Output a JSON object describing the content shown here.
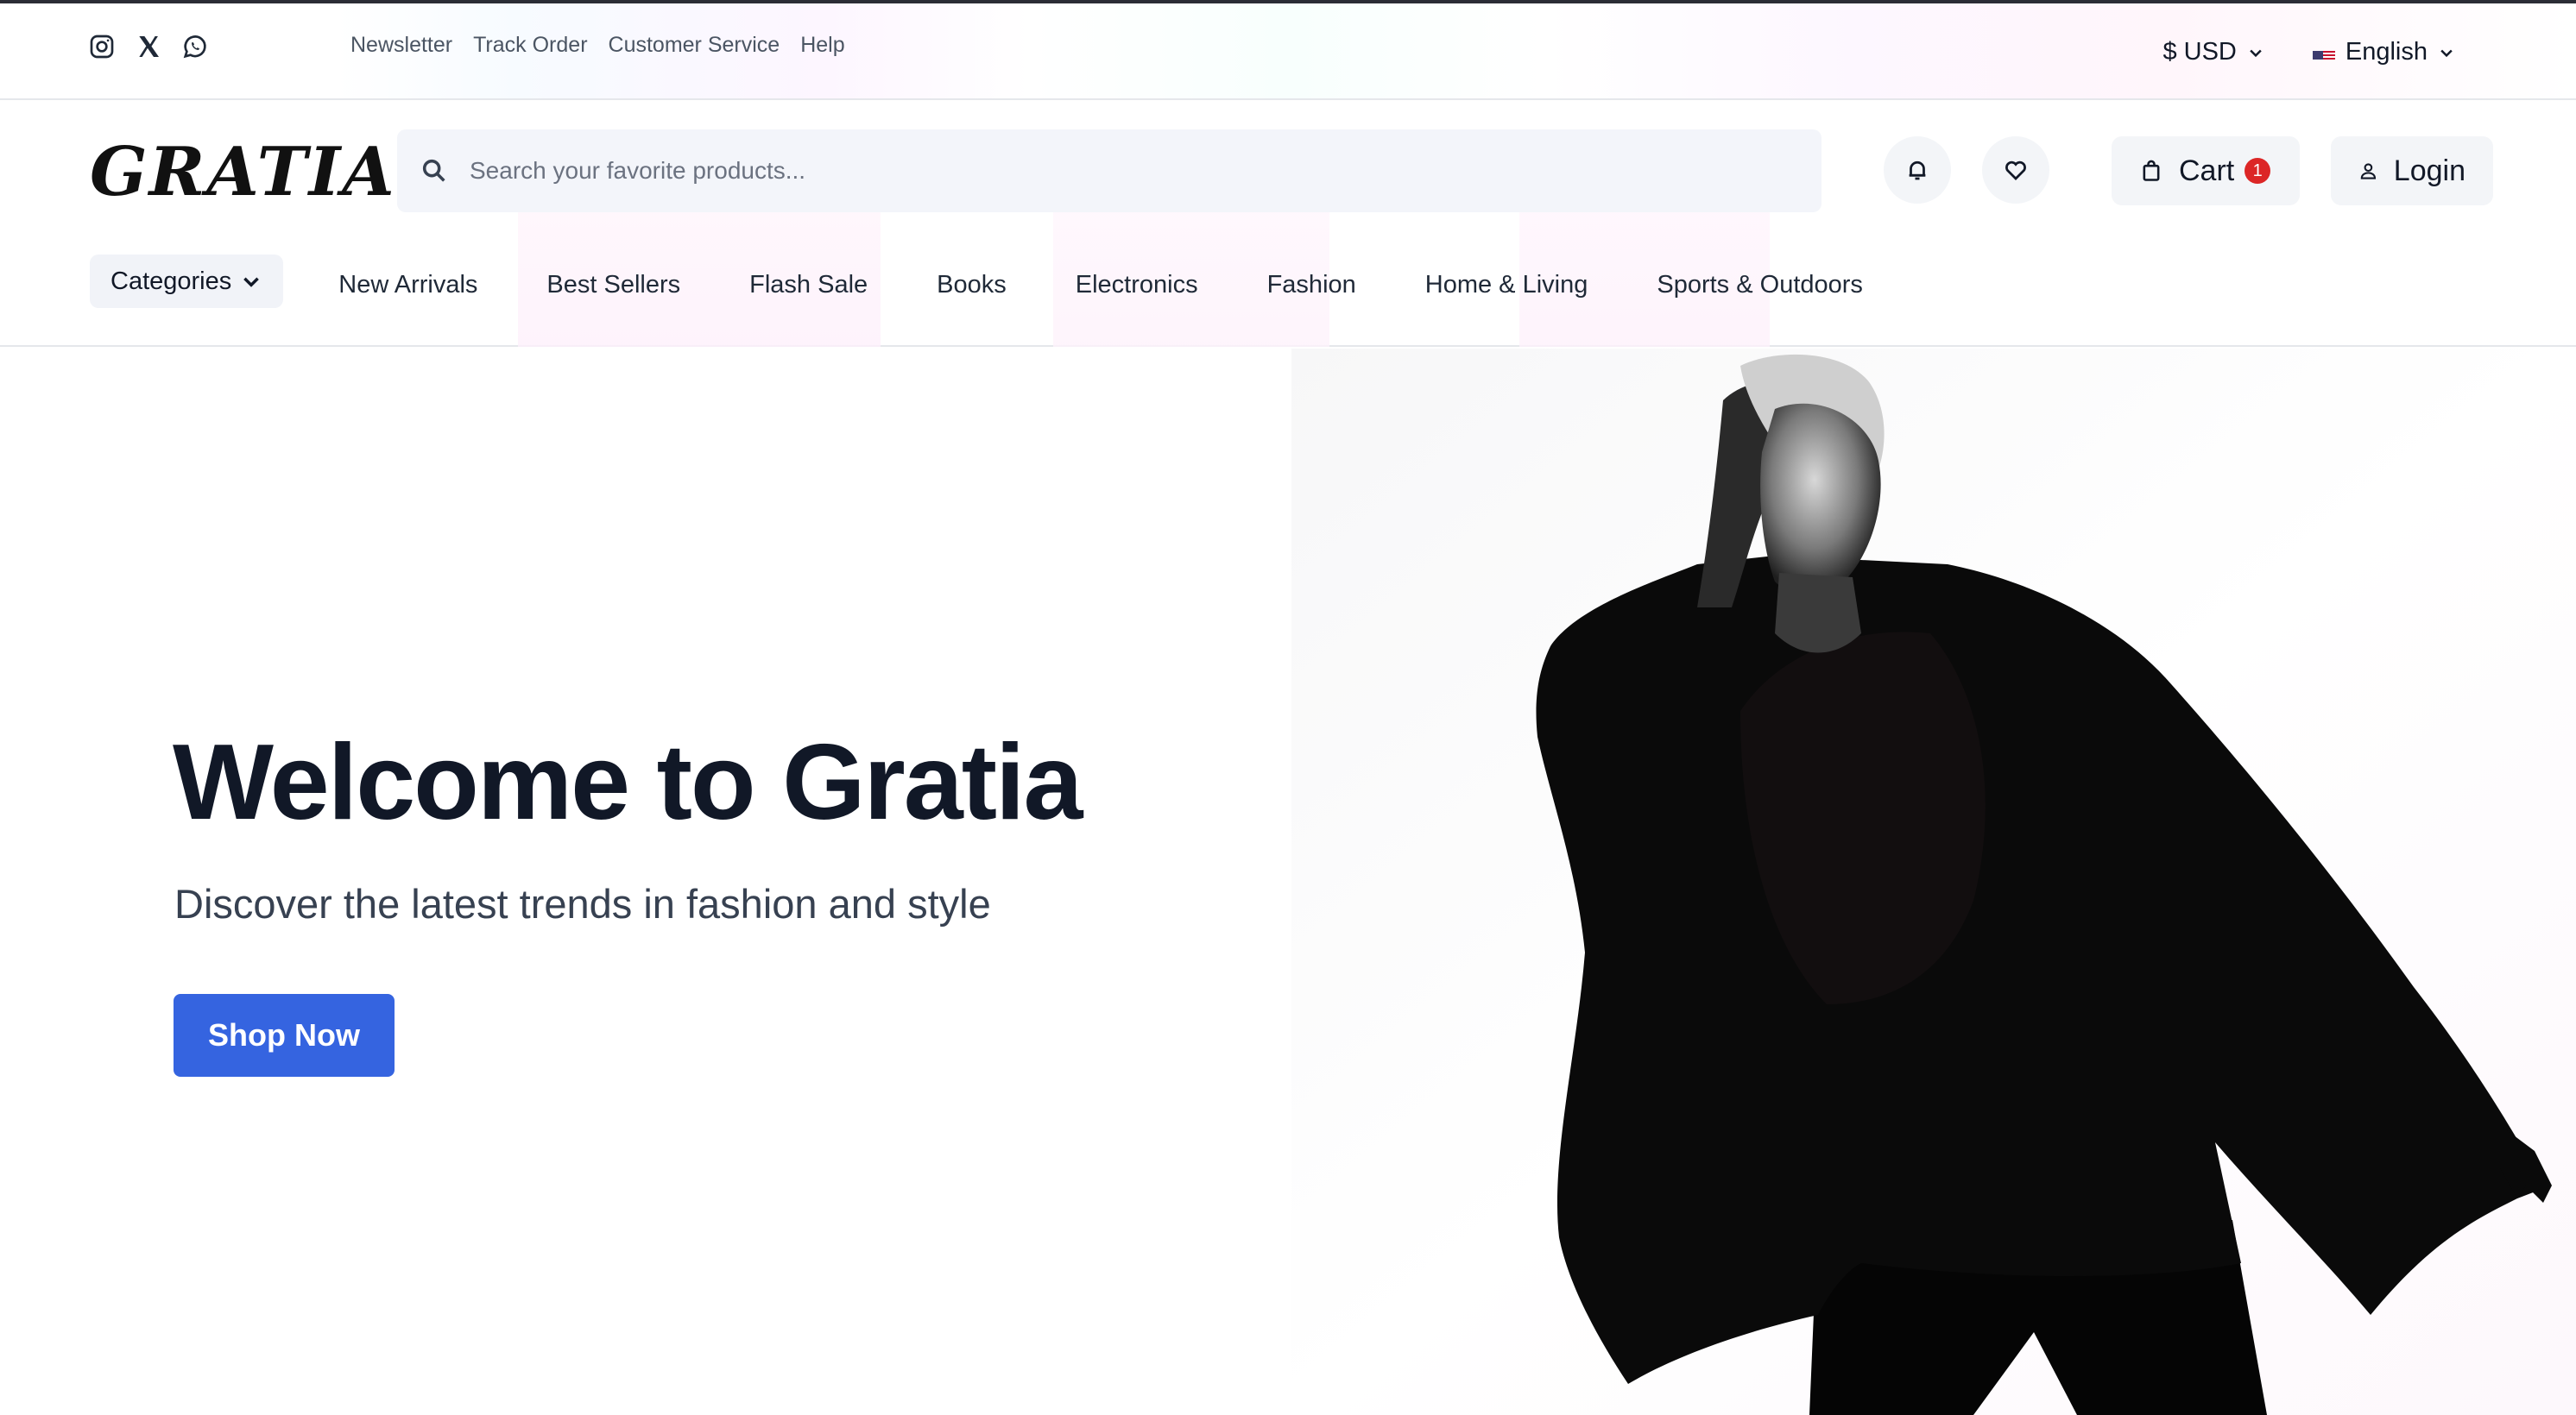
{
  "utility": {
    "social": [
      "instagram-icon",
      "x-twitter-icon",
      "whatsapp-icon"
    ],
    "links": [
      "Newsletter",
      "Track Order",
      "Customer Service",
      "Help"
    ],
    "currency": "$ USD",
    "language": "English"
  },
  "header": {
    "logo": "GRATIA",
    "search_placeholder": "Search your favorite products...",
    "cart_label": "Cart",
    "cart_count": "1",
    "login_label": "Login"
  },
  "nav": {
    "categories_label": "Categories",
    "items": [
      "New Arrivals",
      "Best Sellers",
      "Flash Sale",
      "Books",
      "Electronics",
      "Fashion",
      "Home & Living",
      "Sports & Outdoors"
    ]
  },
  "hero": {
    "title": "Welcome to Gratia",
    "subtitle": "Discover the latest trends in fashion and style",
    "cta": "Shop Now"
  },
  "colors": {
    "primary": "#3564e0",
    "badge": "#dc2626",
    "text": "#111827"
  }
}
